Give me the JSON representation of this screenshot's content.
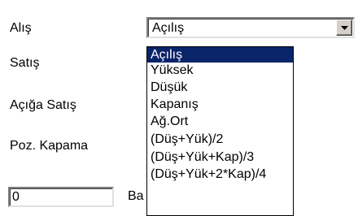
{
  "labels": {
    "alis": "Alış",
    "satis": "Satış",
    "aciga_satis": "Açığa Satış",
    "poz_kapama": "Poz. Kapama"
  },
  "combo": {
    "value": "Açılış",
    "button_icon": "chevron-down-icon"
  },
  "dropdown": {
    "items": [
      "Açılış",
      "Yüksek",
      "Düşük",
      "Kapanış",
      "Ağ.Ort",
      "(Düş+Yük)/2",
      "(Düş+Yük+Kap)/3",
      "(Düş+Yük+2*Kap)/4"
    ],
    "selected_index": 0
  },
  "bottom": {
    "input_value": "0",
    "trailing_label": "Ba"
  },
  "colors": {
    "selection": "#0a246a",
    "face": "#d4d0c8"
  }
}
